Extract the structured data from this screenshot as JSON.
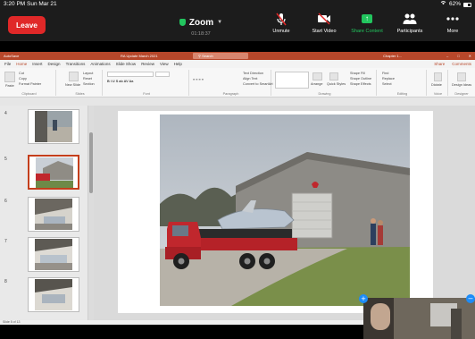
{
  "status_bar": {
    "time_date": "3:20 PM  Sun Mar 21",
    "battery": "62%"
  },
  "zoom": {
    "leave_label": "Leave",
    "title": "Zoom",
    "timer": "01:18:37",
    "actions": [
      {
        "label": "Unmute",
        "icon": "mic-muted-icon"
      },
      {
        "label": "Start Video",
        "icon": "video-off-icon"
      },
      {
        "label": "Share Content",
        "icon": "share-icon"
      },
      {
        "label": "Participants",
        "icon": "participants-icon"
      },
      {
        "label": "More",
        "icon": "more-icon"
      }
    ]
  },
  "ppt": {
    "autosave": "AutoSave",
    "doc_title": "RA Update March 2021",
    "search_placeholder": "Search",
    "user": "Chapter 1...",
    "menu": [
      "File",
      "Home",
      "Insert",
      "Design",
      "Transitions",
      "Animations",
      "Slide Show",
      "Review",
      "View",
      "Help"
    ],
    "menu_active": "Home",
    "share": "Share",
    "comments": "Comments",
    "ribbon": {
      "paste": "Paste",
      "cut": "Cut",
      "copy": "Copy",
      "format_painter": "Format Painter",
      "clipboard": "Clipboard",
      "new_slide": "New Slide",
      "layout": "Layout",
      "reset": "Reset",
      "section": "Section",
      "slides": "Slides",
      "font": "Font",
      "text_direction": "Text Direction",
      "align_text": "Align Text",
      "smartart": "Convert to SmartArt",
      "paragraph": "Paragraph",
      "arrange": "Arrange",
      "quick_styles": "Quick Styles",
      "shape_fill": "Shape Fill",
      "shape_outline": "Shape Outline",
      "shape_effects": "Shape Effects",
      "drawing": "Drawing",
      "find": "Find",
      "replace": "Replace",
      "select": "Select",
      "editing": "Editing",
      "dictate": "Dictate",
      "voice": "Voice",
      "design_ideas": "Design Ideas",
      "designer": "Designer"
    },
    "thumbnails": [
      {
        "num": "4"
      },
      {
        "num": "5"
      },
      {
        "num": "6"
      },
      {
        "num": "7"
      },
      {
        "num": "8"
      }
    ],
    "status_text": "Slide 5 of 13"
  },
  "colors": {
    "leave": "#e02828",
    "share_green": "#22c55e",
    "ppt_brand": "#b7472a",
    "zoom_blue": "#1d8cf8"
  }
}
